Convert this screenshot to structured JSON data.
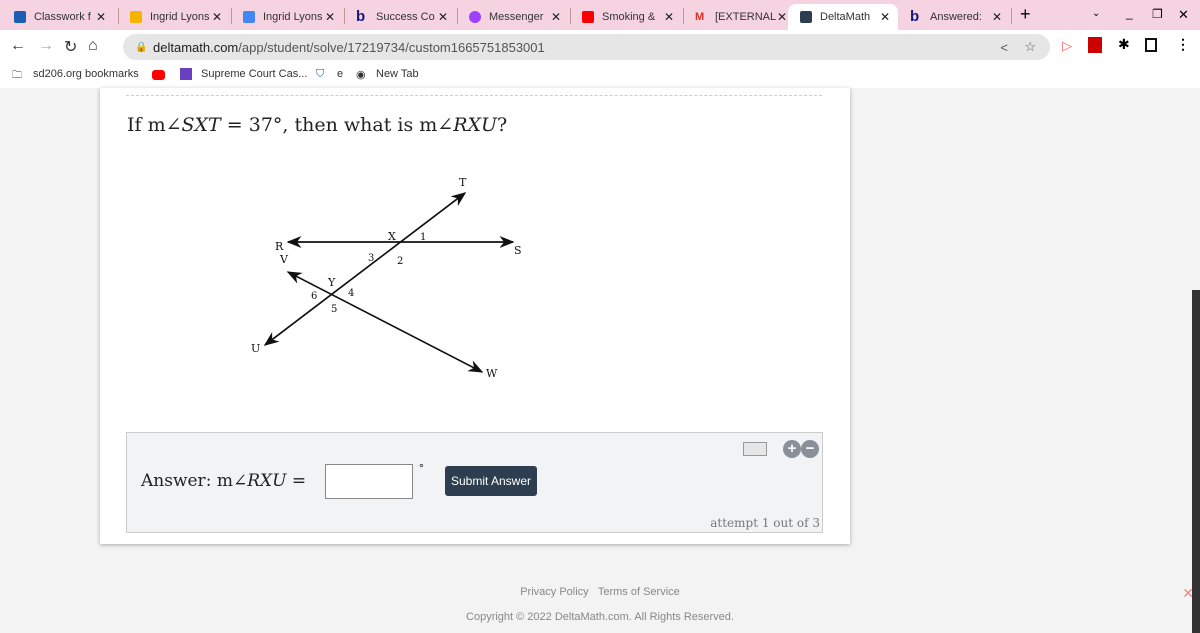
{
  "browser": {
    "tabs": [
      {
        "label": "Classwork f",
        "color": "#1a5fb4"
      },
      {
        "label": "Ingrid Lyons",
        "color": "#f4b400"
      },
      {
        "label": "Ingrid Lyons",
        "color": "#4285f4"
      },
      {
        "label": "Success Co",
        "color": "#1a1a7a"
      },
      {
        "label": "Messenger",
        "color": "#a040ff"
      },
      {
        "label": "Smoking &",
        "color": "#ff0000"
      },
      {
        "label": "[EXTERNAL",
        "color": "#d93025"
      },
      {
        "label": "DeltaMath",
        "color": "#2c3e50"
      },
      {
        "label": "Answered:",
        "color": "#1a1a7a"
      }
    ],
    "url_host": "deltamath.com",
    "url_path": "/app/student/solve/17219734/custom1665751853001",
    "bookmarks": [
      "sd206.org bookmarks",
      "Supreme Court Cas...",
      "e",
      "New Tab"
    ]
  },
  "question": {
    "prefix": "If m",
    "angle1": "∠SXT",
    "eq": " = 37°, then what is m",
    "angle2": "∠RXU",
    "suffix": "?"
  },
  "diagram": {
    "points": [
      "T",
      "X",
      "1",
      "R",
      "S",
      "V",
      "3",
      "2",
      "Y",
      "6",
      "4",
      "5",
      "U",
      "W"
    ]
  },
  "answer": {
    "label_prefix": "Answer: m",
    "label_angle": "∠RXU",
    "label_eq": " =",
    "value": "",
    "unit": "°",
    "submit": "Submit Answer",
    "attempt": "attempt 1 out of 3"
  },
  "footer": {
    "privacy": "Privacy Policy",
    "terms": "Terms of Service",
    "copyright": "Copyright © 2022 DeltaMath.com. All Rights Reserved."
  }
}
